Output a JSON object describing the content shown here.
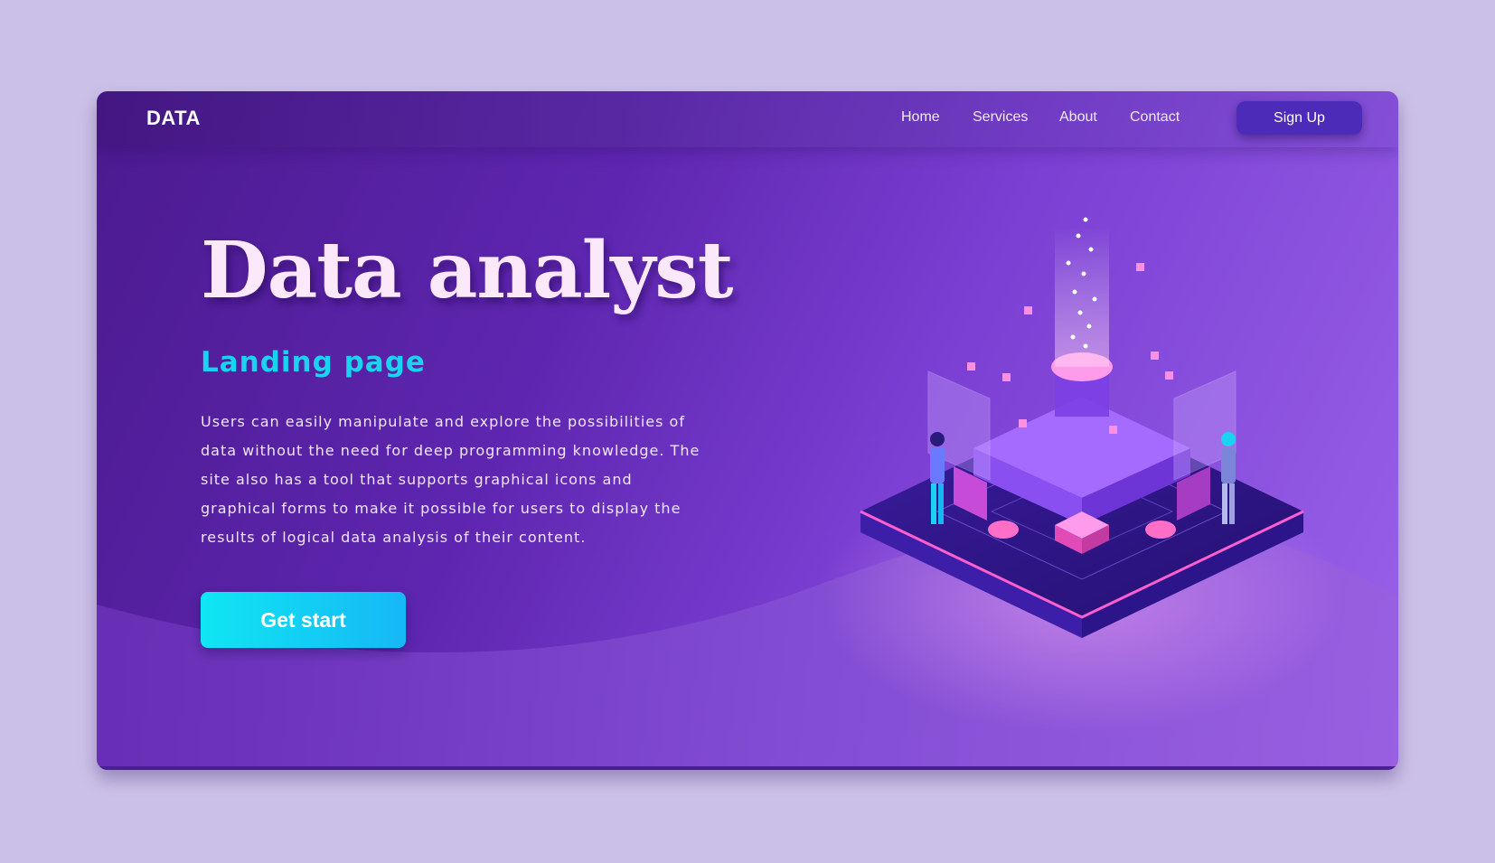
{
  "nav": {
    "logo": "DATA",
    "links": [
      "Home",
      "Services",
      "About",
      "Contact"
    ],
    "signup_label": "Sign Up"
  },
  "hero": {
    "title": "Data analyst",
    "subtitle": "Landing page",
    "description": "Users can easily manipulate and explore the possibilities of data without the need for deep programming knowledge. The site also has a tool that supports graphical icons and graphical forms to make it possible for users to display the results of logical data analysis of their content.",
    "cta_label": "Get start"
  },
  "colors": {
    "page_background": "#cbc1e8",
    "card_purple": "#5e26b0",
    "accent_cyan": "#19d3f0",
    "signup_button": "#4b2bb8",
    "title_text": "#fbe8fb"
  }
}
